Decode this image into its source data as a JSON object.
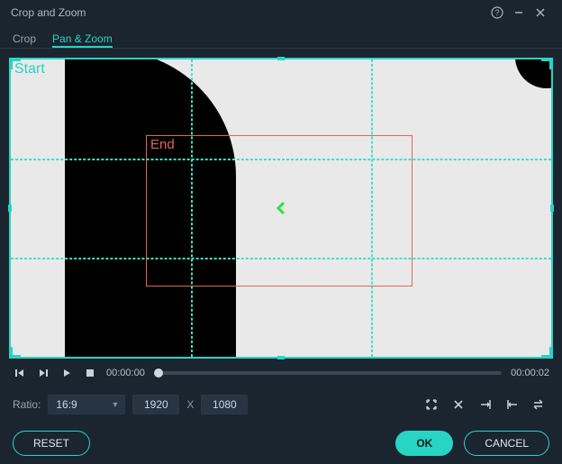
{
  "window": {
    "title": "Crop and Zoom"
  },
  "tabs": {
    "crop": "Crop",
    "pan_zoom": "Pan & Zoom",
    "active": "pan_zoom"
  },
  "frames": {
    "start": {
      "label": "Start"
    },
    "end": {
      "label": "End"
    }
  },
  "playback": {
    "current": "00:00:00",
    "duration": "00:00:02"
  },
  "ratio": {
    "label": "Ratio:",
    "selected": "16:9",
    "width": "1920",
    "separator": "X",
    "height": "1080"
  },
  "buttons": {
    "reset": "RESET",
    "ok": "OK",
    "cancel": "CANCEL"
  },
  "icons": {
    "help": "help-icon",
    "minimize": "minimize-icon",
    "close": "close-icon",
    "step_back": "step-back-icon",
    "play_step": "play-step-icon",
    "play": "play-icon",
    "stop": "stop-icon",
    "fit": "fit-icon",
    "center": "center-icon",
    "align_left": "align-left-icon",
    "align_right": "align-right-icon",
    "swap": "swap-icon"
  }
}
